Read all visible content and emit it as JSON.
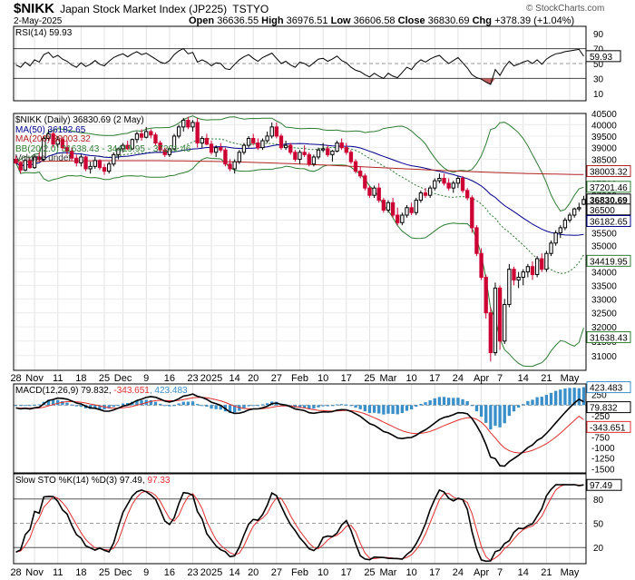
{
  "header": {
    "symbol": "$NIKK",
    "name": "Japan Stock Market Index (JP225)",
    "exchange": "TSTYO",
    "watermark": "© StockCharts.com",
    "date": "2-May-2025",
    "open_label": "Open",
    "open": "36636.55",
    "high_label": "High",
    "high": "36976.51",
    "low_label": "Low",
    "low": "36606.58",
    "close_label": "Close",
    "close": "36830.69",
    "chg_label": "Chg",
    "chg": "+378.39 (+1.04%)"
  },
  "colors": {
    "up": "#000000",
    "down": "#cc0033",
    "ma50": "#00008b",
    "ma200": "#b22222",
    "bb": "#2e7d32",
    "macd_hist": "#3b8fc9",
    "signal": "#e03030",
    "rsi_fill": "#c06060"
  },
  "legends": {
    "rsi": "RSI(14) 59.93",
    "price": "$NIKK (Daily) 36830.69 (2 May)",
    "ma50": "MA(50) 36182.65",
    "ma200": "MA(200) 38003.32",
    "bb": "BB(20,2.0) 31638.43 - 34419.95 - 37201.46",
    "volume": "Volume undef",
    "macd_pre": "MACD(12,26,9) 79.832, ",
    "macd_signal": "-343.651",
    "macd_hist": ", 423.483",
    "sto_pre": "Slow STO %K(14) %D(3) 97.49, ",
    "sto_d": "97.33"
  },
  "chart_data": [
    {
      "type": "candlestick",
      "title": "$NIKK (Daily) 36830.69 (2 May)",
      "ylim": [
        30500,
        40500
      ],
      "scale": "log",
      "y_ticks": [
        31000,
        31500,
        32000,
        32500,
        33000,
        33500,
        34000,
        34500,
        35000,
        35500,
        36000,
        36500,
        37000,
        37500,
        38000,
        38500,
        39000,
        39500,
        40000,
        40500
      ],
      "x_labels": [
        "28",
        "Nov",
        "11",
        "18",
        "25",
        "Dec",
        "9",
        "16",
        "23",
        "2025",
        "14",
        "20",
        "27",
        "Feb",
        "10",
        "17",
        "25",
        "Mar",
        "10",
        "17",
        "24",
        "Apr",
        "7",
        "14",
        "21",
        "May"
      ],
      "x_label_index": [
        0,
        4,
        9,
        14,
        19,
        23,
        28,
        33,
        38,
        42,
        47,
        51,
        56,
        61,
        66,
        71,
        76,
        80,
        85,
        90,
        95,
        100,
        104,
        109,
        114,
        119
      ],
      "ohlc": [
        [
          38500,
          38650,
          38300,
          38350
        ],
        [
          38350,
          38400,
          37900,
          38050
        ],
        [
          38050,
          38500,
          38000,
          38450
        ],
        [
          38450,
          38550,
          38100,
          38150
        ],
        [
          38150,
          38700,
          38100,
          38600
        ],
        [
          38600,
          38800,
          38400,
          38500
        ],
        [
          38500,
          39500,
          38400,
          39400
        ],
        [
          39400,
          39800,
          39300,
          39600
        ],
        [
          39600,
          39700,
          39000,
          39150
        ],
        [
          39150,
          39500,
          39000,
          39350
        ],
        [
          39350,
          39450,
          38900,
          39000
        ],
        [
          39000,
          39300,
          38700,
          38850
        ],
        [
          38850,
          39000,
          38450,
          38550
        ],
        [
          38550,
          38700,
          38200,
          38350
        ],
        [
          38350,
          38700,
          38200,
          38600
        ],
        [
          38600,
          38650,
          38000,
          38100
        ],
        [
          38100,
          38400,
          37900,
          38200
        ],
        [
          38200,
          38600,
          38100,
          38450
        ],
        [
          38450,
          38500,
          38050,
          38150
        ],
        [
          38150,
          38300,
          37850,
          38000
        ],
        [
          38000,
          38400,
          37900,
          38300
        ],
        [
          38300,
          38800,
          38200,
          38700
        ],
        [
          38700,
          39000,
          38500,
          38950
        ],
        [
          38950,
          39200,
          38800,
          39100
        ],
        [
          39100,
          39300,
          38900,
          38950
        ],
        [
          38950,
          39400,
          38900,
          39350
        ],
        [
          39350,
          39700,
          39200,
          39600
        ],
        [
          39600,
          39800,
          39300,
          39450
        ],
        [
          39450,
          39900,
          39400,
          39700
        ],
        [
          39700,
          39800,
          39400,
          39550
        ],
        [
          39550,
          39650,
          39100,
          39200
        ],
        [
          39200,
          39300,
          38800,
          38900
        ],
        [
          38900,
          39000,
          38600,
          38700
        ],
        [
          38700,
          39000,
          38600,
          38950
        ],
        [
          38950,
          39600,
          38900,
          39500
        ],
        [
          39500,
          40000,
          39400,
          39900
        ],
        [
          39900,
          40300,
          39700,
          40200
        ],
        [
          40200,
          40350,
          39800,
          39900
        ],
        [
          39900,
          40200,
          39700,
          40100
        ],
        [
          40100,
          40300,
          39000,
          39200
        ],
        [
          39200,
          39500,
          39000,
          39400
        ],
        [
          39400,
          39600,
          39100,
          39150
        ],
        [
          39150,
          39300,
          38700,
          38800
        ],
        [
          38800,
          39100,
          38600,
          39000
        ],
        [
          39000,
          39200,
          38800,
          38900
        ],
        [
          38900,
          39000,
          38200,
          38300
        ],
        [
          38300,
          38500,
          38000,
          38100
        ],
        [
          38100,
          38500,
          37900,
          38400
        ],
        [
          38400,
          38900,
          38300,
          38800
        ],
        [
          38800,
          39200,
          38700,
          39100
        ],
        [
          39100,
          39500,
          39000,
          39400
        ],
        [
          39400,
          39600,
          39100,
          39200
        ],
        [
          39200,
          39400,
          38900,
          39000
        ],
        [
          39000,
          39400,
          38900,
          39300
        ],
        [
          39300,
          39700,
          39200,
          39500
        ],
        [
          39500,
          40100,
          39400,
          39900
        ],
        [
          39900,
          40100,
          39400,
          39500
        ],
        [
          39500,
          39600,
          38900,
          39000
        ],
        [
          39000,
          39300,
          38900,
          39100
        ],
        [
          39100,
          39200,
          38700,
          38800
        ],
        [
          38800,
          38900,
          38400,
          38500
        ],
        [
          38500,
          38900,
          38300,
          38800
        ],
        [
          38800,
          39100,
          38600,
          38700
        ],
        [
          38700,
          38800,
          38200,
          38300
        ],
        [
          38300,
          38700,
          38200,
          38600
        ],
        [
          38600,
          39000,
          38500,
          38900
        ],
        [
          38900,
          39200,
          38800,
          38950
        ],
        [
          38950,
          39100,
          38600,
          38700
        ],
        [
          38700,
          38900,
          38400,
          38850
        ],
        [
          38850,
          39300,
          38800,
          39200
        ],
        [
          39200,
          39400,
          38900,
          39000
        ],
        [
          39000,
          39200,
          38700,
          38800
        ],
        [
          38800,
          38900,
          38300,
          38400
        ],
        [
          38400,
          38500,
          37900,
          38000
        ],
        [
          38000,
          38200,
          37700,
          37800
        ],
        [
          37800,
          37900,
          37200,
          37300
        ],
        [
          37300,
          37400,
          36900,
          37000
        ],
        [
          37000,
          37400,
          36900,
          37300
        ],
        [
          37300,
          37500,
          36700,
          36800
        ],
        [
          36800,
          36900,
          36300,
          36400
        ],
        [
          36400,
          36800,
          36300,
          36700
        ],
        [
          36700,
          36900,
          36100,
          36200
        ],
        [
          36200,
          36500,
          35800,
          35900
        ],
        [
          35900,
          36300,
          35800,
          36200
        ],
        [
          36200,
          36600,
          36100,
          36500
        ],
        [
          36500,
          36700,
          36200,
          36300
        ],
        [
          36300,
          36900,
          36200,
          36800
        ],
        [
          36800,
          37200,
          36700,
          37100
        ],
        [
          37100,
          37300,
          36900,
          37000
        ],
        [
          37000,
          37400,
          36900,
          37300
        ],
        [
          37300,
          37700,
          37200,
          37600
        ],
        [
          37600,
          37900,
          37500,
          37700
        ],
        [
          37700,
          37900,
          37400,
          37500
        ],
        [
          37500,
          37700,
          37200,
          37300
        ],
        [
          37300,
          37600,
          37100,
          37500
        ],
        [
          37500,
          37800,
          37300,
          37700
        ],
        [
          37700,
          37800,
          37100,
          37200
        ],
        [
          37200,
          37300,
          36800,
          36900
        ],
        [
          36900,
          37000,
          35500,
          35700
        ],
        [
          35700,
          35800,
          34600,
          34700
        ],
        [
          34700,
          34900,
          33700,
          33800
        ],
        [
          33800,
          33900,
          32300,
          32500
        ],
        [
          32500,
          32700,
          30800,
          31100
        ],
        [
          31100,
          33600,
          31000,
          33400
        ],
        [
          33400,
          33500,
          31200,
          31500
        ],
        [
          31500,
          33000,
          31400,
          32800
        ],
        [
          32800,
          34300,
          32700,
          34100
        ],
        [
          34100,
          34200,
          33500,
          33700
        ],
        [
          33700,
          34000,
          33400,
          33800
        ],
        [
          33800,
          34100,
          33500,
          34000
        ],
        [
          34000,
          34300,
          33800,
          34200
        ],
        [
          34200,
          34400,
          33700,
          33900
        ],
        [
          33900,
          34600,
          33800,
          34500
        ],
        [
          34500,
          34700,
          34000,
          34100
        ],
        [
          34100,
          34800,
          34000,
          34700
        ],
        [
          34700,
          35200,
          34600,
          35100
        ],
        [
          35100,
          35600,
          35000,
          35500
        ],
        [
          35500,
          35800,
          35300,
          35700
        ],
        [
          35700,
          36100,
          35600,
          36000
        ],
        [
          36000,
          36300,
          35900,
          36200
        ],
        [
          36200,
          36500,
          36100,
          36450
        ],
        [
          36450,
          36700,
          36350,
          36500
        ],
        [
          36636.55,
          36976.51,
          36606.58,
          36830.69
        ]
      ],
      "ma50_last": 36182.65,
      "ma200_last": 38003.32,
      "bb_last": {
        "lower": 31638.43,
        "mid": 34419.95,
        "upper": 37201.46
      },
      "right_labels": [
        "38003.32",
        "37201.46",
        "36830.69",
        "36500",
        "36182.65",
        "34419.95",
        "31638.43"
      ]
    },
    {
      "type": "line",
      "title": "RSI(14) 59.93",
      "ylim": [
        0,
        100
      ],
      "y_ticks": [
        10,
        30,
        50,
        70,
        90
      ],
      "reference_lines": [
        30,
        50,
        70
      ],
      "last": 59.93,
      "values": [
        48,
        45,
        52,
        47,
        55,
        52,
        62,
        65,
        58,
        61,
        56,
        53,
        48,
        45,
        51,
        46,
        49,
        54,
        49,
        47,
        53,
        58,
        61,
        63,
        59,
        63,
        66,
        62,
        64,
        60,
        56,
        52,
        50,
        54,
        62,
        67,
        70,
        63,
        65,
        52,
        55,
        52,
        47,
        51,
        50,
        43,
        42,
        49,
        55,
        59,
        62,
        57,
        53,
        58,
        61,
        64,
        57,
        50,
        53,
        48,
        45,
        52,
        50,
        46,
        51,
        56,
        57,
        53,
        56,
        60,
        54,
        51,
        45,
        41,
        39,
        35,
        32,
        37,
        33,
        30,
        37,
        33,
        31,
        38,
        45,
        42,
        50,
        55,
        52,
        56,
        59,
        61,
        55,
        50,
        54,
        58,
        51,
        44,
        35,
        31,
        29,
        25,
        22,
        42,
        34,
        45,
        53,
        47,
        49,
        52,
        54,
        50,
        55,
        49,
        56,
        60,
        63,
        64,
        66,
        67,
        68,
        69,
        59.93
      ]
    },
    {
      "type": "bar+line",
      "title": "MACD(12,26,9)",
      "ylim": [
        -1600,
        500
      ],
      "y_ticks": [
        250,
        0,
        -250,
        -500,
        -750,
        -1000,
        -1250,
        -1500
      ],
      "macd_last": 79.832,
      "signal_last": -343.651,
      "hist_last": 423.483,
      "right_labels": [
        "423.483",
        "79.832",
        "-343.651"
      ]
    },
    {
      "type": "line",
      "title": "Slow STO %K(14) %D(3)",
      "ylim": [
        0,
        100
      ],
      "y_ticks": [
        20,
        50,
        80
      ],
      "reference_lines": [
        20,
        50,
        80
      ],
      "k_last": 97.49,
      "d_last": 97.33,
      "right_labels": [
        "97.49"
      ]
    }
  ]
}
